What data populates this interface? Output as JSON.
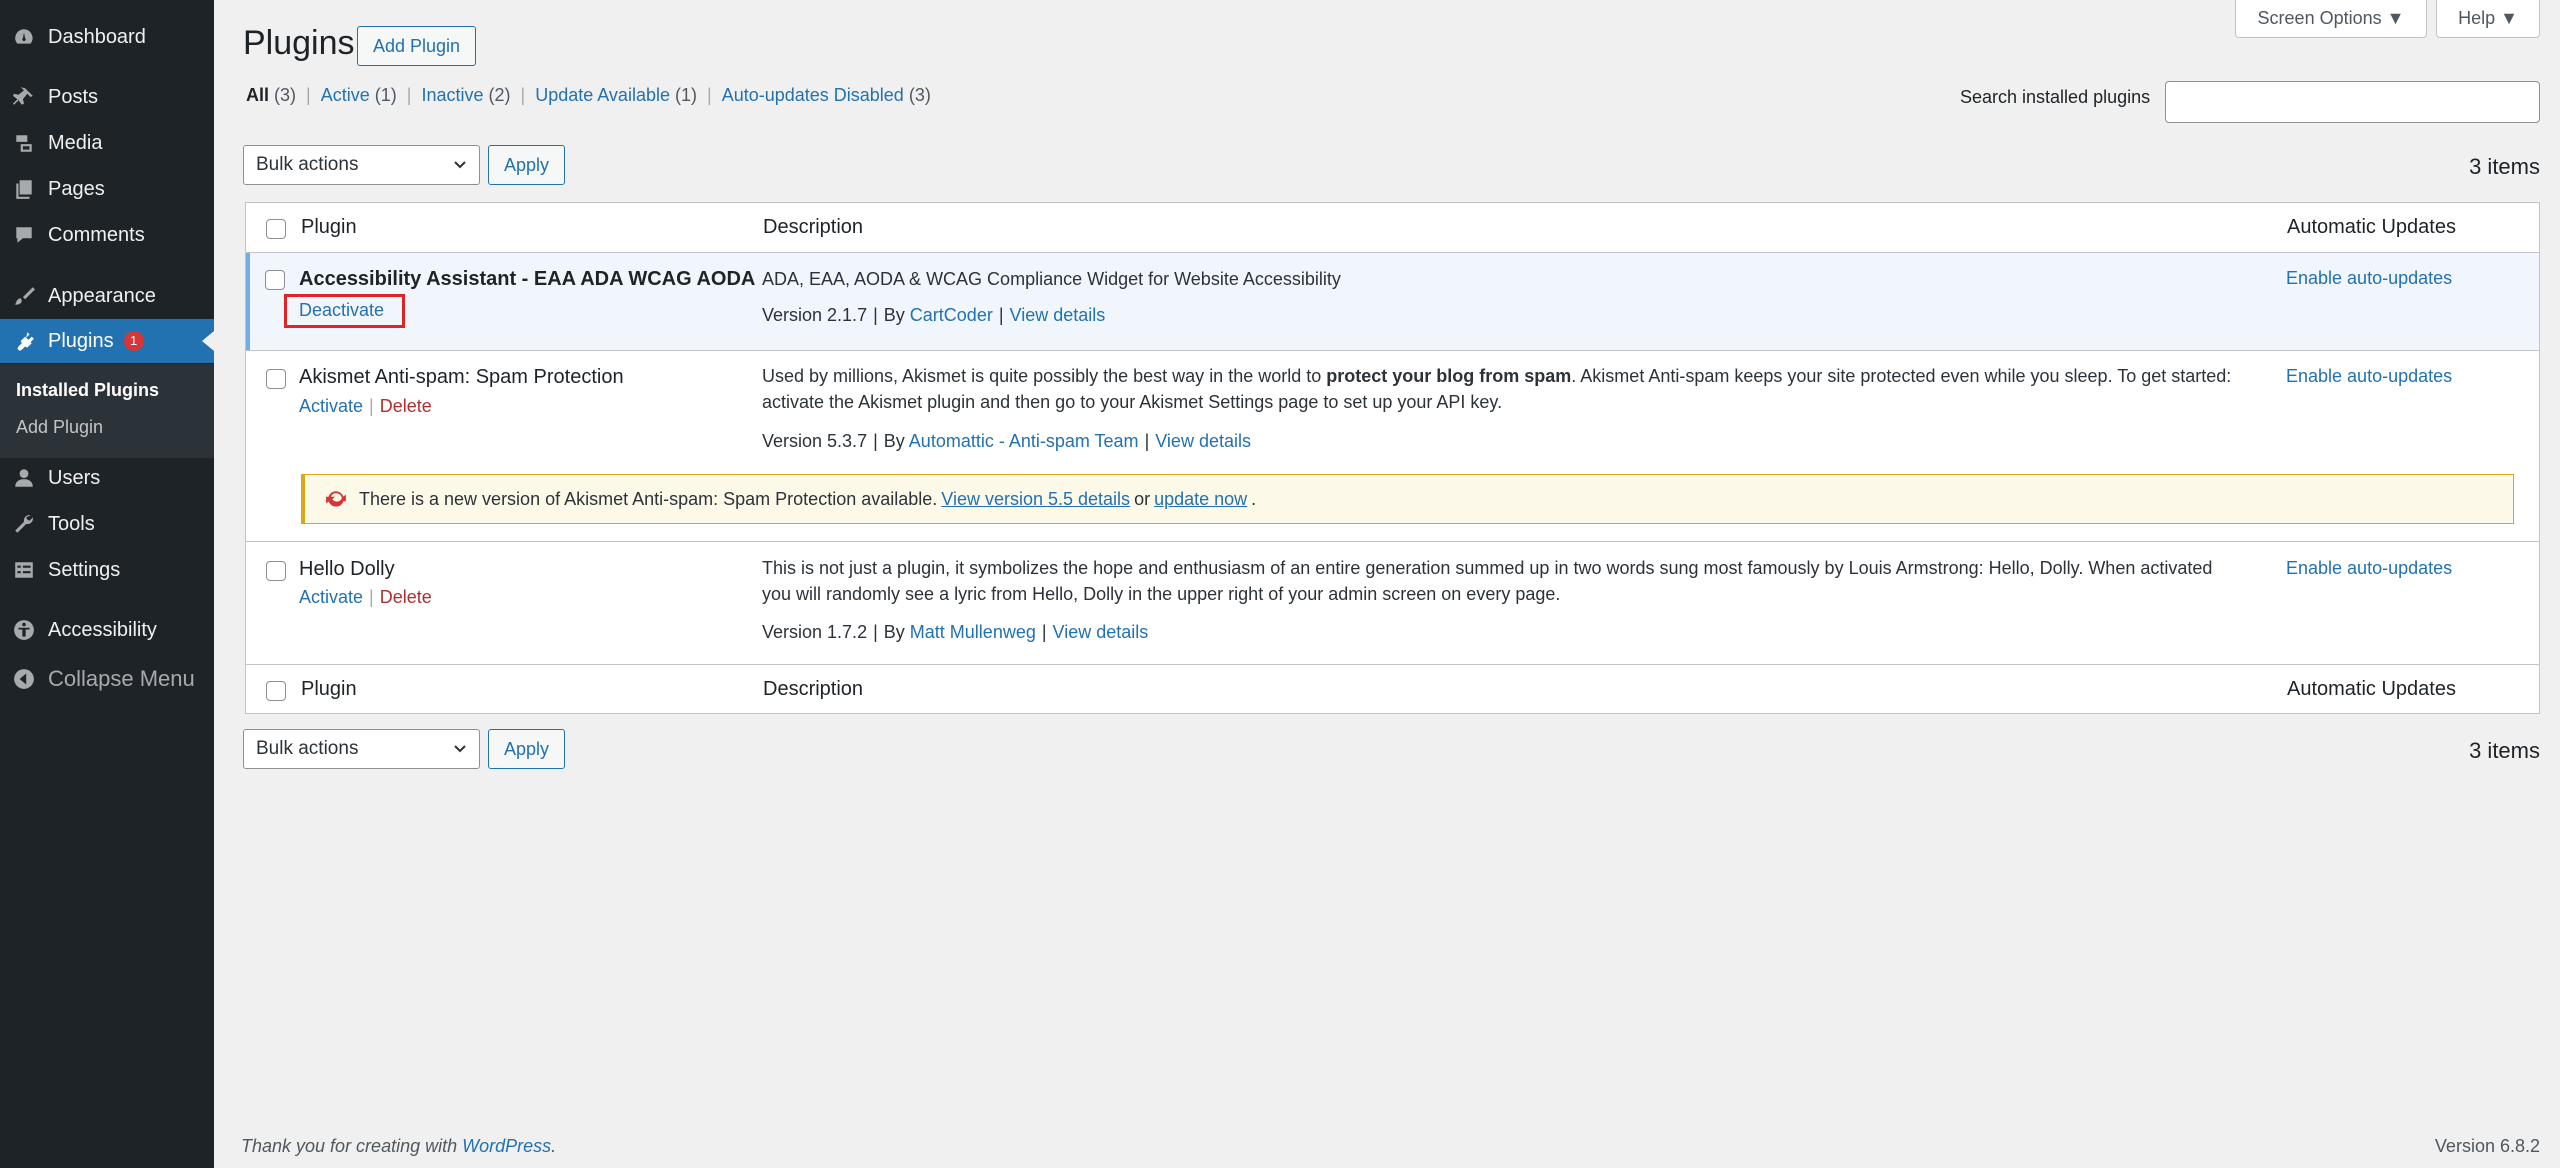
{
  "sidebar": {
    "items": [
      {
        "label": "Dashboard",
        "icon": "dashboard-icon"
      },
      {
        "label": "Posts",
        "icon": "pin-icon"
      },
      {
        "label": "Media",
        "icon": "media-icon"
      },
      {
        "label": "Pages",
        "icon": "pages-icon"
      },
      {
        "label": "Comments",
        "icon": "comments-icon"
      },
      {
        "label": "Appearance",
        "icon": "brush-icon"
      },
      {
        "label": "Plugins",
        "icon": "plugin-icon",
        "badge": "1"
      },
      {
        "label": "Users",
        "icon": "users-icon"
      },
      {
        "label": "Tools",
        "icon": "wrench-icon"
      },
      {
        "label": "Settings",
        "icon": "settings-icon"
      },
      {
        "label": "Accessibility",
        "icon": "accessibility-icon"
      },
      {
        "label": "Collapse Menu",
        "icon": "collapse-icon"
      }
    ],
    "submenu": [
      "Installed Plugins",
      "Add Plugin"
    ]
  },
  "header": {
    "title": "Plugins",
    "add_button": "Add Plugin",
    "screen_options": "Screen Options ▼",
    "help": "Help ▼"
  },
  "views": [
    {
      "label": "All",
      "count": "(3)"
    },
    {
      "label": "Active",
      "count": "(1)"
    },
    {
      "label": "Inactive",
      "count": "(2)"
    },
    {
      "label": "Update Available",
      "count": "(1)"
    },
    {
      "label": "Auto-updates Disabled",
      "count": "(3)"
    }
  ],
  "search": {
    "label": "Search installed plugins",
    "value": ""
  },
  "bulk": {
    "select": "Bulk actions",
    "apply": "Apply",
    "items": "3 items"
  },
  "table": {
    "columns": [
      "Plugin",
      "Description",
      "Automatic Updates"
    ],
    "plugins": [
      {
        "name": "Accessibility Assistant - EAA ADA WCAG AODA",
        "actions": [
          "Deactivate"
        ],
        "description": "ADA, EAA, AODA & WCAG Compliance Widget for Website Accessibility",
        "version": "Version 2.1.7",
        "by": "By",
        "author": "CartCoder",
        "details": "View details",
        "auto": "Enable auto-updates"
      },
      {
        "name": "Akismet Anti-spam: Spam Protection",
        "actions": [
          "Activate",
          "Delete"
        ],
        "description_pre": "Used by millions, Akismet is quite possibly the best way in the world to",
        "description_bold": "protect your blog from spam",
        "description_post": ". Akismet Anti-spam keeps your site protected even while you sleep. To get started: activate the Akismet plugin and then go to your Akismet Settings page to set up your API key.",
        "version": "Version 5.3.7",
        "by": "By",
        "author": "Automattic - Anti-spam Team",
        "details": "View details",
        "auto": "Enable auto-updates",
        "notice": {
          "text": "There is a new version of Akismet Anti-spam: Spam Protection available.",
          "link1": "View version 5.5 details",
          "or": "or",
          "link2": "update now",
          "end": "."
        }
      },
      {
        "name": "Hello Dolly",
        "actions": [
          "Activate",
          "Delete"
        ],
        "description": "This is not just a plugin, it symbolizes the hope and enthusiasm of an entire generation summed up in two words sung most famously by Louis Armstrong: Hello, Dolly. When activated you will randomly see a lyric from Hello, Dolly in the upper right of your admin screen on every page.",
        "version": "Version 1.7.2",
        "by": "By",
        "author": "Matt Mullenweg",
        "details": "View details",
        "auto": "Enable auto-updates"
      }
    ]
  },
  "footer": {
    "text": "Thank you for creating with",
    "link": "WordPress",
    "end": ".",
    "version": "Version 6.8.2"
  },
  "colors": {
    "accent": "#2271b1",
    "sidebar_bg": "#1d2327",
    "highlight": "#e02424"
  }
}
